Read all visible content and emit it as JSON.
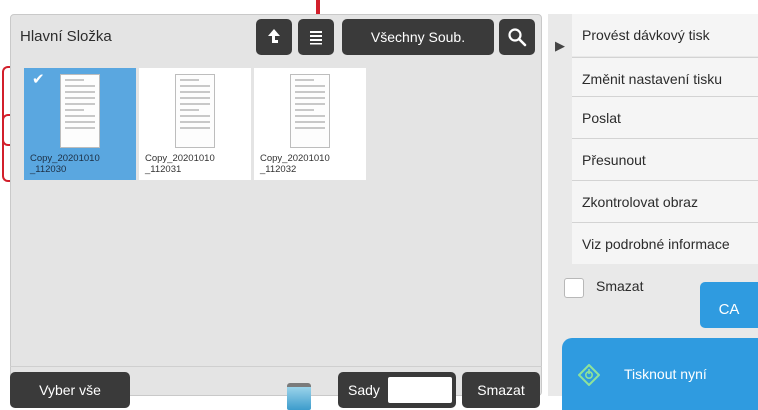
{
  "header": {
    "folder_title": "Hlavní Složka",
    "filter_label": "Všechny Soub."
  },
  "files": [
    {
      "name": "Copy_20201010\n_112030",
      "selected": true
    },
    {
      "name": "Copy_20201010\n_112031",
      "selected": false
    },
    {
      "name": "Copy_20201010\n_112032",
      "selected": false
    }
  ],
  "footer": {
    "select_all_label": "Vyber vše",
    "sets_label": "Sady",
    "sets_value": "",
    "delete_label": "Smazat"
  },
  "side_menu": [
    {
      "label": "Provést dávkový tisk"
    },
    {
      "label": "Změnit nastavení tisku"
    },
    {
      "label": "Poslat"
    },
    {
      "label": "Přesunout"
    },
    {
      "label": "Zkontrolovat obraz"
    },
    {
      "label": "Viz podrobné informace"
    }
  ],
  "delete_checkbox": {
    "label": "Smazat",
    "checked": false
  },
  "ca_label": "CA",
  "print_now_label": "Tisknout nyní",
  "colors": {
    "accent": "#2f9be0",
    "selection": "#5aa7e0",
    "callout": "#d21f2b"
  }
}
